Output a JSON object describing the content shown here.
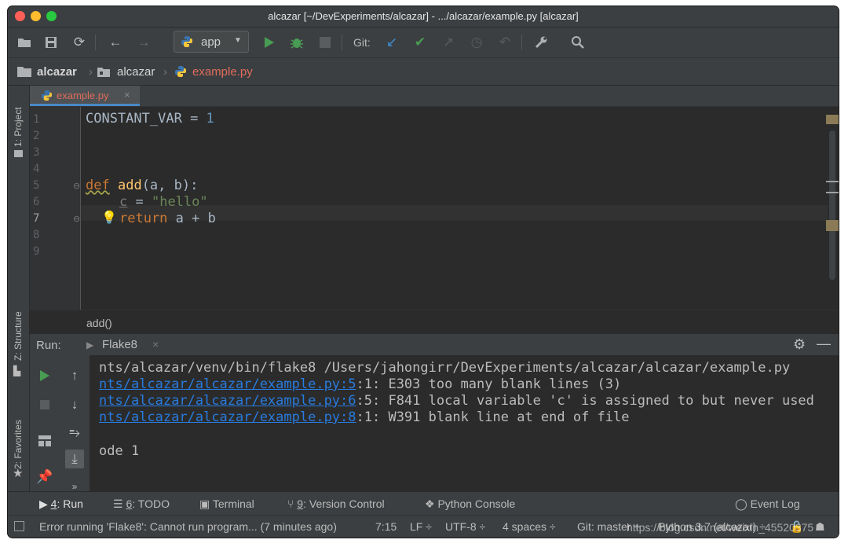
{
  "window": {
    "title": "alcazar [~/DevExperiments/alcazar] - .../alcazar/example.py [alcazar]"
  },
  "toolbar": {
    "run_config": "app",
    "git_label": "Git:"
  },
  "breadcrumb": {
    "items": [
      "alcazar",
      "alcazar",
      "example.py"
    ]
  },
  "side_panels": {
    "project": "1: Project",
    "structure": "Z: Structure",
    "favorites": "2: Favorites"
  },
  "editor": {
    "tab_label": "example.py",
    "line_numbers": [
      "1",
      "2",
      "3",
      "4",
      "5",
      "6",
      "7",
      "8",
      "9"
    ],
    "lines": {
      "l1_name": "CONSTANT_VAR",
      "l1_eq": " = ",
      "l1_val": "1",
      "l5_def": "def",
      "l5_name": "add",
      "l5_args": "(a, b):",
      "l6_var": "c",
      "l6_eq": " = ",
      "l6_str": "\"hello\"",
      "l7_ret": "return",
      "l7_expr": " a + b"
    },
    "breadcrumb_fn": "add()"
  },
  "run_panel": {
    "label": "Run:",
    "tab": "Flake8",
    "console": {
      "command": "nts/alcazar/venv/bin/flake8 /Users/jahongirr/DevExperiments/alcazar/alcazar/example.py",
      "errors": [
        {
          "link": "nts/alcazar/alcazar/example.py:5",
          "text": ":1: E303 too many blank lines (3)"
        },
        {
          "link": "nts/alcazar/alcazar/example.py:6",
          "text": ":5: F841 local variable 'c' is assigned to but never used"
        },
        {
          "link": "nts/alcazar/alcazar/example.py:8",
          "text": ":1: W391 blank line at end of file"
        }
      ],
      "exit": "ode 1"
    }
  },
  "tool_windows": {
    "run": {
      "num": "4",
      "label": ": Run"
    },
    "todo": {
      "num": "6",
      "label": ": TODO"
    },
    "terminal": "Terminal",
    "vcs": {
      "num": "9",
      "label": ": Version Control"
    },
    "python_console": "Python Console",
    "event_log": "Event Log"
  },
  "status": {
    "message": "Error running 'Flake8': Cannot run program... (7 minutes ago)",
    "position": "7:15",
    "line_sep": "LF ÷",
    "encoding": "UTF-8 ÷",
    "indent": "4 spaces ÷",
    "git": "Git: master ÷",
    "interpreter": "Python 3.7 (alcazar) ÷",
    "watermark": "https://blog.csdn.net/weixin_45520375"
  },
  "colors": {
    "accent": "#4a88c7",
    "run_green": "#499c54",
    "link_blue": "#287bde",
    "keyword": "#cc7832",
    "function": "#ffc66d",
    "string": "#6a8759",
    "number": "#6897bb",
    "tab_file_red": "#e06c5c"
  }
}
